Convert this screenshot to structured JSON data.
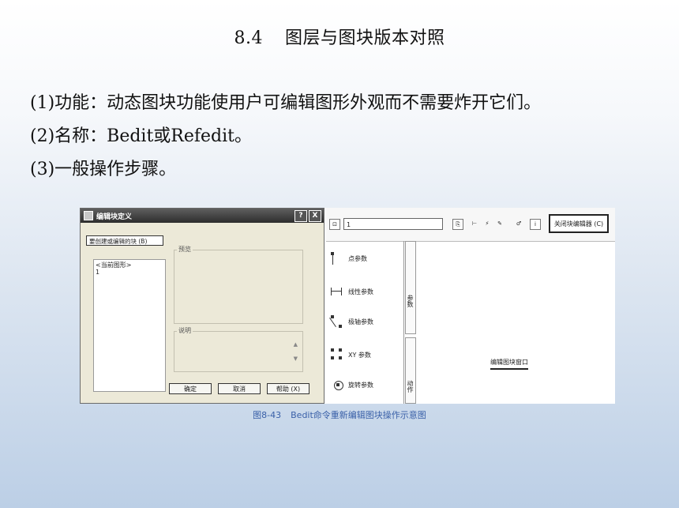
{
  "slide": {
    "section_number": "8.4",
    "title": "图层与图块版本对照",
    "bullets": [
      "(1)功能：动态图块功能使用户可编辑图形外观而不需要炸开它们。",
      "(2)名称：Bedit或Refedit。",
      "(3)一般操作步骤。"
    ]
  },
  "dialog": {
    "title": "编辑块定义",
    "help_btn": "?",
    "close_btn": "X",
    "create_label": "要创建或编辑的块 (B)",
    "list_items": [
      "<当前图形>",
      "1"
    ],
    "preview_label": "预览",
    "description_label": "说明",
    "ok_label": "确定",
    "cancel_label": "取消",
    "help_label": "帮助 (X)"
  },
  "editor": {
    "block_name_value": "1",
    "close_editor_label": "关闭块编辑器 (C)",
    "palette_items": [
      "点参数",
      "线性参数",
      "极轴参数",
      "XY 参数",
      "旋转参数"
    ],
    "tab_params": "参数",
    "tab_actions": "动作",
    "canvas_label": "编辑图块窗口"
  },
  "figure": {
    "number": "图8-43",
    "caption": "Bedit命令重新编辑图块操作示意图"
  }
}
